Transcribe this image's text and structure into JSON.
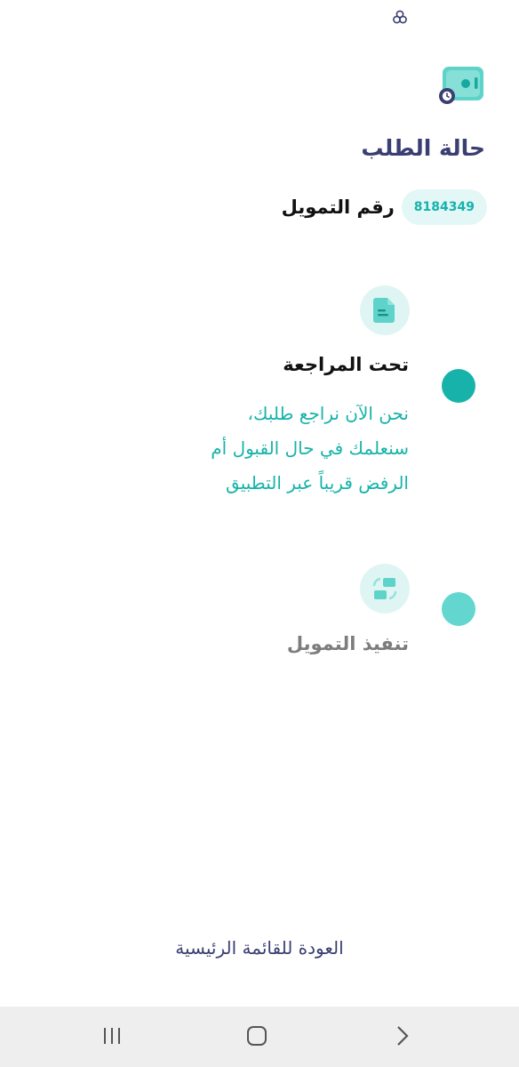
{
  "header": {
    "title": "حالة الطلب"
  },
  "reference": {
    "label": "رقم التمويل",
    "number": "8184349"
  },
  "steps": [
    {
      "title": "تحت المراجعة",
      "description_lines": [
        "نحن الآن نراجع طلبك،",
        "سنعلمك في حال القبول أم",
        "الرفض قريباً عبر التطبيق"
      ],
      "icon": "document-icon",
      "state": "active"
    },
    {
      "title": "تنفيذ التمويل",
      "icon": "transfer-icon",
      "state": "pending"
    }
  ],
  "footer": {
    "back_label": "العودة للقائمة الرئيسية"
  },
  "navbar": {
    "icons": [
      "recent-apps-icon",
      "home-icon",
      "back-icon"
    ]
  },
  "colors": {
    "primary_teal": "#17b3aa",
    "light_teal": "#dff5f4",
    "navy": "#3a3f72",
    "pending_dot": "#63d6cf"
  }
}
